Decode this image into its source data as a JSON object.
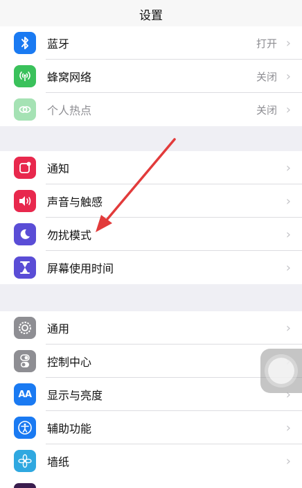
{
  "header": {
    "title": "设置"
  },
  "group1": [
    {
      "label": "蓝牙",
      "value": "打开",
      "icon": "bluetooth-icon",
      "color": "#1a7af2"
    },
    {
      "label": "蜂窝网络",
      "value": "关闭",
      "icon": "cellular-icon",
      "color": "#3ac15b"
    },
    {
      "label": "个人热点",
      "value": "关闭",
      "icon": "hotspot-icon",
      "color": "#3ac15b",
      "disabled": true
    }
  ],
  "group2": [
    {
      "label": "通知",
      "icon": "notifications-icon",
      "color": "#e8284d"
    },
    {
      "label": "声音与触感",
      "icon": "sound-icon",
      "color": "#e8284d"
    },
    {
      "label": "勿扰模式",
      "icon": "moon-icon",
      "color": "#5a4dd6"
    },
    {
      "label": "屏幕使用时间",
      "icon": "hourglass-icon",
      "color": "#5a4dd6"
    }
  ],
  "group3": [
    {
      "label": "通用",
      "icon": "gear-icon",
      "color": "#8e8e93"
    },
    {
      "label": "控制中心",
      "icon": "toggles-icon",
      "color": "#8e8e93"
    },
    {
      "label": "显示与亮度",
      "icon": "text-size-icon",
      "color": "#1a7af2",
      "glyph": "AA"
    },
    {
      "label": "辅助功能",
      "icon": "accessibility-icon",
      "color": "#1a7af2"
    },
    {
      "label": "墙纸",
      "icon": "wallpaper-icon",
      "color": "#2fa8e0"
    }
  ],
  "chevron": "›",
  "colors": {
    "annotation_arrow": "#e23b3b",
    "background": "#efeff4"
  }
}
